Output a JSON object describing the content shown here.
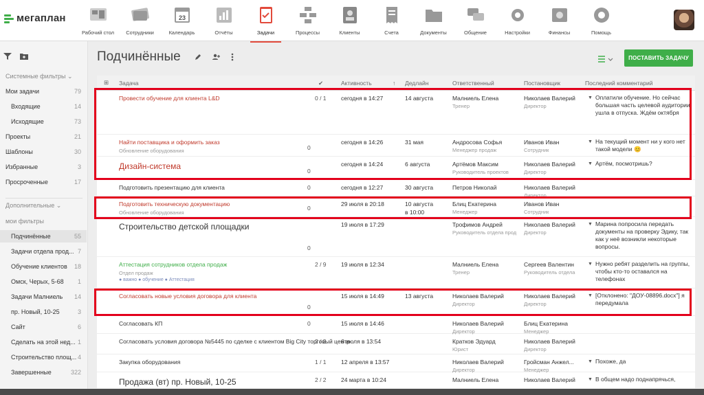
{
  "logo": "мегаплан",
  "nav": [
    {
      "label": "Рабочий стол",
      "icon": "desktop-icon"
    },
    {
      "label": "Сотрудники",
      "icon": "employees-icon"
    },
    {
      "label": "Календарь",
      "icon": "calendar-icon",
      "date": "23"
    },
    {
      "label": "Отчёты",
      "icon": "reports-icon"
    },
    {
      "label": "Задачи",
      "icon": "tasks-icon",
      "active": true
    },
    {
      "label": "Процессы",
      "icon": "processes-icon"
    },
    {
      "label": "Клиенты",
      "icon": "clients-icon"
    },
    {
      "label": "Счета",
      "icon": "invoices-icon"
    },
    {
      "label": "Документы",
      "icon": "documents-icon"
    },
    {
      "label": "Общение",
      "icon": "chat-icon"
    },
    {
      "label": "Настройки",
      "icon": "settings-icon"
    },
    {
      "label": "Финансы",
      "icon": "finance-icon"
    },
    {
      "label": "Помощь",
      "icon": "help-icon"
    }
  ],
  "sidebar": {
    "system_filters": "Системные фильтры",
    "items": [
      {
        "label": "Мои задачи",
        "count": "79"
      },
      {
        "label": "Входящие",
        "count": "14",
        "indent": true
      },
      {
        "label": "Исходящие",
        "count": "73",
        "indent": true
      },
      {
        "label": "Проекты",
        "count": "21"
      },
      {
        "label": "Шаблоны",
        "count": "30"
      },
      {
        "label": "Избранные",
        "count": "3"
      },
      {
        "label": "Просроченные",
        "count": "17"
      }
    ],
    "extra": "Дополнительные",
    "my_filters": "мои фильтры",
    "filters": [
      {
        "label": "Подчинённые",
        "count": "55",
        "selected": true
      },
      {
        "label": "Задачи отдела прод...",
        "count": "7"
      },
      {
        "label": "Обучение клиентов",
        "count": "18"
      },
      {
        "label": "Омск, Черых, 5-68",
        "count": "1"
      },
      {
        "label": "Задачи Малниель",
        "count": "14"
      },
      {
        "label": "пр. Новый, 10-25",
        "count": "3"
      },
      {
        "label": "Сайт",
        "count": "6"
      },
      {
        "label": "Сделать на этой нед...",
        "count": "1"
      },
      {
        "label": "Строительство площ...",
        "count": "4"
      },
      {
        "label": "Завершенные",
        "count": "322"
      }
    ]
  },
  "page_title": "Подчинённые",
  "add_task": "ПОСТАВИТЬ ЗАДАЧУ",
  "columns": {
    "task": "Задача",
    "activity": "Активность",
    "deadline": "Дедлайн",
    "responsible": "Ответственный",
    "author": "Постановщик",
    "comment": "Последний комментарий"
  },
  "rows": [
    {
      "task": "Провести обучение для клиента L&D",
      "style": "red",
      "progress": "0 / 1",
      "activity": "сегодня в 14:27",
      "deadline": "14 августа",
      "resp": "Малниель Елена",
      "resp_role": "Тренер",
      "author": "Николаев Валерий",
      "author_role": "Директор",
      "comment": "Оплатили обучение. Но сейчас большая часть целевой аудитории ушла в отпуска. Ждём октября"
    },
    {
      "task": "Найти поставщика и оформить заказ",
      "sub": "Обновление оборудования",
      "style": "red",
      "progress": "0",
      "activity": "сегодня в 14:26",
      "deadline": "31 мая",
      "resp": "Андросова Софья",
      "resp_role": "Менеджер продаж",
      "author": "Иванов Иван",
      "author_role": "Сотрудник",
      "comment": "На текущий момент ни у кого нет такой модели 😊"
    },
    {
      "task": "Дизайн-система",
      "style": "red big",
      "progress": "0",
      "activity": "сегодня в 14:24",
      "deadline": "6 августа",
      "resp": "Артёмов Максим",
      "resp_role": "Руководитель проектов",
      "author": "Николаев Валерий",
      "author_role": "Директор",
      "comment": "Артём, посмотришь?"
    },
    {
      "task": "Подготовить презентацию для клиента",
      "style": "",
      "progress": "0",
      "activity": "сегодня в 12:27",
      "deadline": "30 августа",
      "resp": "Петров Николай",
      "resp_role": "",
      "author": "Николаев Валерий",
      "author_role": "Директор",
      "comment": ""
    },
    {
      "task": "Подготовить техническую документацию",
      "sub": "Обновление оборудования",
      "style": "red",
      "progress": "0",
      "activity": "29 июля в 20:18",
      "deadline": "10 августа",
      "deadline2": "в 10:00",
      "resp": "Блиц Екатерина",
      "resp_role": "Менеджер",
      "author": "Иванов Иван",
      "author_role": "Сотрудник",
      "comment": ""
    },
    {
      "task": "Строительство детской площадки",
      "style": "big",
      "progress": "0",
      "activity": "19 июля в 17:29",
      "deadline": "",
      "resp": "Трофимов Андрей",
      "resp_role": "Руководитель отдела прод",
      "author": "Николаев Валерий",
      "author_role": "Директор",
      "comment": "Марина попросила передать документы на проверку Эдику, так как у неё возникли некоторые вопросы."
    },
    {
      "task": "Аттестация сотрудников отдела продаж",
      "sub": "Отдел продаж",
      "tags": "● важно  ● обучение  ● Аттестация",
      "style": "green",
      "progress": "2 / 9",
      "activity": "19 июля в 12:34",
      "deadline": "",
      "resp": "Малниель Елена",
      "resp_role": "Тренер",
      "author": "Сергеев Валентин",
      "author_role": "Руководитель отдела",
      "comment": "Нужно ребят разделить на группы, чтобы кто-то оставался на телефонах"
    },
    {
      "task": "Согласовать новые условия договора для клиента",
      "style": "red",
      "progress": "0",
      "activity": "15 июля в 14:49",
      "deadline": "13 августа",
      "resp": "Николаев Валерий",
      "resp_role": "Директор",
      "author": "Николаев Валерий",
      "author_role": "Директор",
      "comment": "[Отклонено: \"ДОУ-08896.docx\"] я передумала"
    },
    {
      "task": "Согласовать КП",
      "style": "",
      "progress": "0",
      "activity": "15 июля в 14:46",
      "deadline": "",
      "resp": "Николаев Валерий",
      "resp_role": "Директор",
      "author": "Блиц Екатерина",
      "author_role": "Менеджер",
      "comment": ""
    },
    {
      "task": "Согласовать условия договора №5445 по сделке с клиентом Big City торговый центр",
      "style": "",
      "progress": "2 / 3",
      "activity": "6 июля в 13:54",
      "deadline": "",
      "resp": "Кратков Эдуард",
      "resp_role": "Юрист",
      "author": "Николаев Валерий",
      "author_role": "Директор",
      "comment": ""
    },
    {
      "task": "Закупка оборудования",
      "style": "",
      "progress": "1 / 1",
      "activity": "12 апреля в 13:57",
      "deadline": "",
      "resp": "Николаев Валерий",
      "resp_role": "Директор",
      "author": "Гройсман Анжел...",
      "author_role": "Менеджер",
      "comment": "Похоже, да"
    },
    {
      "task": "Продажа (вт) пр. Новый, 10-25",
      "style": "big",
      "progress": "2 / 2",
      "activity": "24 марта в 10:24",
      "deadline": "",
      "resp": "Малниель Елена",
      "resp_role": "",
      "author": "Николаев Валерий",
      "author_role": "",
      "comment": "В общем надо поднапрячься,"
    }
  ],
  "bottom": {
    "search": "Найти в Мегаплане",
    "badge1": "9",
    "badge2": "19",
    "badge3": "1"
  }
}
